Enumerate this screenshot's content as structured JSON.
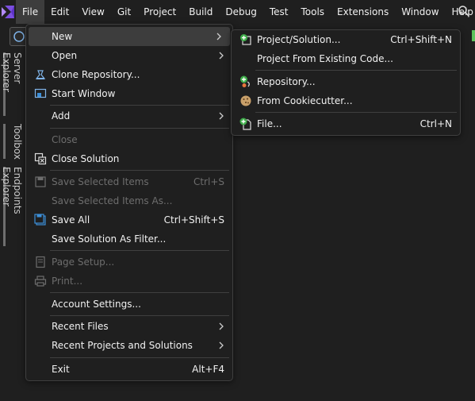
{
  "menubar": {
    "items": [
      "File",
      "Edit",
      "View",
      "Git",
      "Project",
      "Build",
      "Debug",
      "Test",
      "Tools",
      "Extensions",
      "Window",
      "Help"
    ]
  },
  "side_tabs": [
    "Server Explorer",
    "Toolbox",
    "Endpoints Explorer"
  ],
  "file_menu": {
    "new": "New",
    "open": "Open",
    "clone": "Clone Repository...",
    "start_window": "Start Window",
    "add": "Add",
    "close": "Close",
    "close_solution": "Close Solution",
    "save_selected": "Save Selected Items",
    "save_selected_sc": "Ctrl+S",
    "save_selected_as": "Save Selected Items As...",
    "save_all": "Save All",
    "save_all_sc": "Ctrl+Shift+S",
    "save_filter": "Save Solution As Filter...",
    "page_setup": "Page Setup...",
    "print": "Print...",
    "account": "Account Settings...",
    "recent_files": "Recent Files",
    "recent_projects": "Recent Projects and Solutions",
    "exit": "Exit",
    "exit_sc": "Alt+F4"
  },
  "new_menu": {
    "project": "Project/Solution...",
    "project_sc": "Ctrl+Shift+N",
    "existing": "Project From Existing Code...",
    "repository": "Repository...",
    "cookiecutter": "From Cookiecutter...",
    "file": "File...",
    "file_sc": "Ctrl+N"
  },
  "colors": {
    "accent": "#9a6cf5",
    "menu_bg": "#1f1f1f",
    "hover": "#3d3d3d",
    "disabled": "#6d6d6d"
  }
}
